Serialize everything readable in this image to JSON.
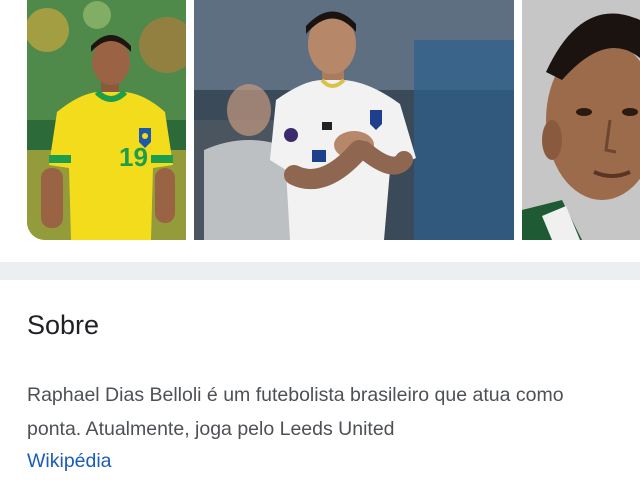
{
  "gallery": {
    "images": [
      {
        "label": "",
        "icon": "photo-player-brazil"
      },
      {
        "label": "",
        "icon": "photo-player-leeds"
      },
      {
        "label": "",
        "icon": "photo-player-portrait"
      }
    ],
    "jersey_number": "19"
  },
  "about": {
    "title": "Sobre",
    "description": "Raphael Dias Belloli é um futebolista brasileiro que atua como ponta. Atualmente, joga pelo Leeds United",
    "source_link": "Wikipédia"
  },
  "colors": {
    "link": "#1a5cb8",
    "title": "#202124",
    "body_text": "#4d5156",
    "divider": "#eceff1",
    "brazil_yellow": "#f2dc1c",
    "brazil_green": "#1e9e4c"
  }
}
